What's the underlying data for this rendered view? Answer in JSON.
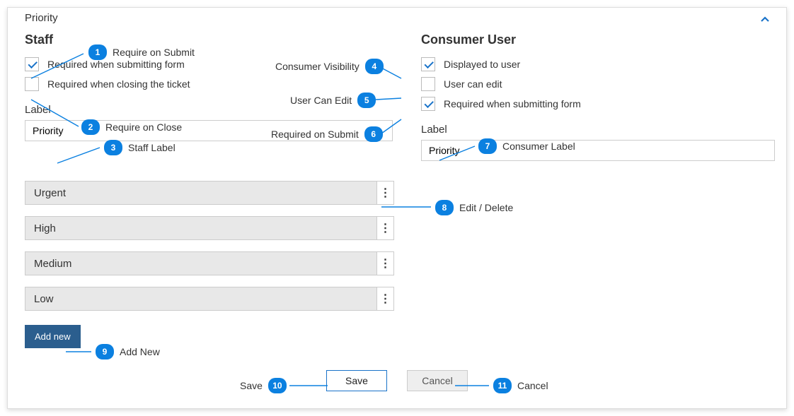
{
  "panel": {
    "title": "Priority"
  },
  "staff": {
    "heading": "Staff",
    "req_submit_label": "Required when submitting form",
    "req_submit_checked": true,
    "req_close_label": "Required when closing the ticket",
    "req_close_checked": false,
    "label_caption": "Label",
    "label_value": "Priority"
  },
  "consumer": {
    "heading": "Consumer User",
    "displayed_label": "Displayed to user",
    "displayed_checked": true,
    "can_edit_label": "User can edit",
    "can_edit_checked": false,
    "req_submit_label": "Required when submitting form",
    "req_submit_checked": true,
    "label_caption": "Label",
    "label_value": "Priority"
  },
  "options": [
    "Urgent",
    "High",
    "Medium",
    "Low"
  ],
  "buttons": {
    "add_new": "Add new",
    "save": "Save",
    "cancel": "Cancel"
  },
  "annotations": {
    "1": "Require on Submit",
    "2": "Require on Close",
    "3": "Staff Label",
    "4": "Consumer Visibility",
    "5": "User Can Edit",
    "6": "Required on Submit",
    "7": "Consumer Label",
    "8": "Edit / Delete",
    "9": "Add New",
    "10": "Save",
    "11": "Cancel"
  }
}
